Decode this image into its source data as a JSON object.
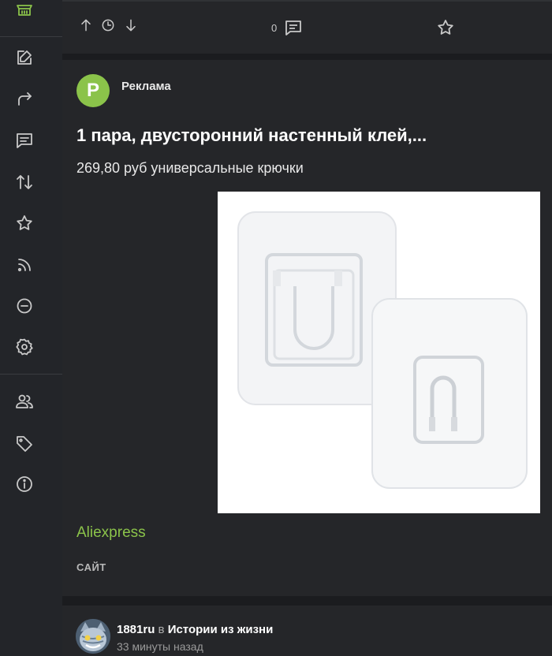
{
  "sidebar": {
    "icons": [
      {
        "name": "basket-icon",
        "color": "#8bc34a"
      },
      {
        "name": "edit-icon"
      },
      {
        "name": "share-icon"
      },
      {
        "name": "comments-icon"
      },
      {
        "name": "sort-icon"
      },
      {
        "name": "star-icon"
      },
      {
        "name": "rss-icon"
      },
      {
        "name": "minus-circle-icon"
      },
      {
        "name": "settings-icon"
      },
      {
        "name": "users-icon"
      },
      {
        "name": "tag-icon"
      },
      {
        "name": "info-icon"
      }
    ]
  },
  "prev_post": {
    "comment_count": "0"
  },
  "ad": {
    "avatar_letter": "P",
    "label": "Реклама",
    "title": "1 пара, двусторонний настенный клей,...",
    "description": "269,80 руб универсальные крючки",
    "site": "Aliexpress",
    "kind": "САЙТ",
    "accent_color": "#8bc34a"
  },
  "post": {
    "author": "1881ru",
    "in_text": "в",
    "community": "Истории из жизни",
    "time": "33 минуты назад"
  }
}
